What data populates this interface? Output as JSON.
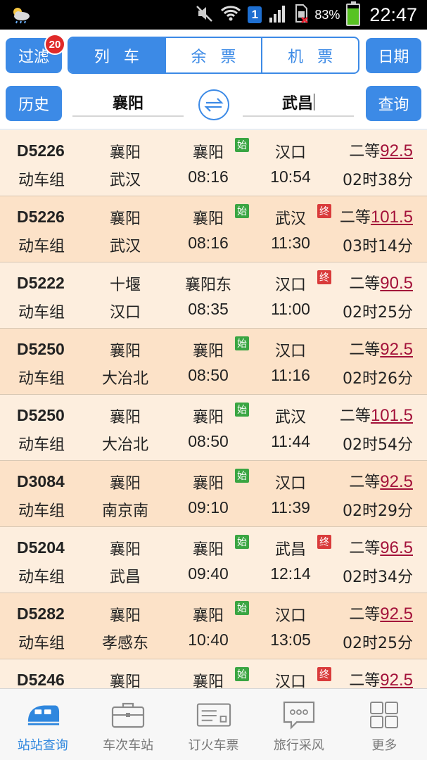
{
  "status_bar": {
    "battery": "83%",
    "time": "22:47",
    "sim": "1"
  },
  "toolbar": {
    "filter_label": "过滤",
    "filter_badge": "20",
    "tabs": [
      {
        "label": "列车",
        "active": true
      },
      {
        "label": "余票",
        "active": false
      },
      {
        "label": "机票",
        "active": false
      }
    ],
    "date_label": "日期"
  },
  "search": {
    "history_label": "历史",
    "from": "襄阳",
    "to": "武昌",
    "query_label": "查询"
  },
  "colors": {
    "accent": "#3c8ae6",
    "price": "#a3123a",
    "start_tag": "#3aa542",
    "end_tag": "#d93b3b"
  },
  "trains": [
    {
      "num": "D5226",
      "type": "动车组",
      "origin": "襄阳",
      "dest": "武汉",
      "dep_station": "襄阳",
      "dep_tag": "始",
      "dep_time": "08:16",
      "arr_station": "汉口",
      "arr_tag": "",
      "arr_time": "10:54",
      "seat": "二等",
      "price": "92.5",
      "duration": "02时38分"
    },
    {
      "num": "D5226",
      "type": "动车组",
      "origin": "襄阳",
      "dest": "武汉",
      "dep_station": "襄阳",
      "dep_tag": "始",
      "dep_time": "08:16",
      "arr_station": "武汉",
      "arr_tag": "终",
      "arr_time": "11:30",
      "seat": "二等",
      "price": "101.5",
      "duration": "03时14分"
    },
    {
      "num": "D5222",
      "type": "动车组",
      "origin": "十堰",
      "dest": "汉口",
      "dep_station": "襄阳东",
      "dep_tag": "",
      "dep_time": "08:35",
      "arr_station": "汉口",
      "arr_tag": "终",
      "arr_time": "11:00",
      "seat": "二等",
      "price": "90.5",
      "duration": "02时25分"
    },
    {
      "num": "D5250",
      "type": "动车组",
      "origin": "襄阳",
      "dest": "大冶北",
      "dep_station": "襄阳",
      "dep_tag": "始",
      "dep_time": "08:50",
      "arr_station": "汉口",
      "arr_tag": "",
      "arr_time": "11:16",
      "seat": "二等",
      "price": "92.5",
      "duration": "02时26分"
    },
    {
      "num": "D5250",
      "type": "动车组",
      "origin": "襄阳",
      "dest": "大冶北",
      "dep_station": "襄阳",
      "dep_tag": "始",
      "dep_time": "08:50",
      "arr_station": "武汉",
      "arr_tag": "",
      "arr_time": "11:44",
      "seat": "二等",
      "price": "101.5",
      "duration": "02时54分"
    },
    {
      "num": "D3084",
      "type": "动车组",
      "origin": "襄阳",
      "dest": "南京南",
      "dep_station": "襄阳",
      "dep_tag": "始",
      "dep_time": "09:10",
      "arr_station": "汉口",
      "arr_tag": "",
      "arr_time": "11:39",
      "seat": "二等",
      "price": "92.5",
      "duration": "02时29分"
    },
    {
      "num": "D5204",
      "type": "动车组",
      "origin": "襄阳",
      "dest": "武昌",
      "dep_station": "襄阳",
      "dep_tag": "始",
      "dep_time": "09:40",
      "arr_station": "武昌",
      "arr_tag": "终",
      "arr_time": "12:14",
      "seat": "二等",
      "price": "96.5",
      "duration": "02时34分"
    },
    {
      "num": "D5282",
      "type": "动车组",
      "origin": "襄阳",
      "dest": "孝感东",
      "dep_station": "襄阳",
      "dep_tag": "始",
      "dep_time": "10:40",
      "arr_station": "汉口",
      "arr_tag": "",
      "arr_time": "13:05",
      "seat": "二等",
      "price": "92.5",
      "duration": "02时25分"
    },
    {
      "num": "D5246",
      "type": "",
      "origin": "襄阳",
      "dest": "",
      "dep_station": "襄阳",
      "dep_tag": "始",
      "dep_time": "",
      "arr_station": "汉口",
      "arr_tag": "终",
      "arr_time": "",
      "seat": "二等",
      "price": "92.5",
      "duration": ""
    }
  ],
  "bottom_nav": [
    {
      "label": "站站查询",
      "icon": "train-icon",
      "active": true
    },
    {
      "label": "车次车站",
      "icon": "briefcase-icon",
      "active": false
    },
    {
      "label": "订火车票",
      "icon": "ticket-icon",
      "active": false
    },
    {
      "label": "旅行采风",
      "icon": "chat-bubble-icon",
      "active": false
    },
    {
      "label": "更多",
      "icon": "grid-icon",
      "active": false
    }
  ]
}
